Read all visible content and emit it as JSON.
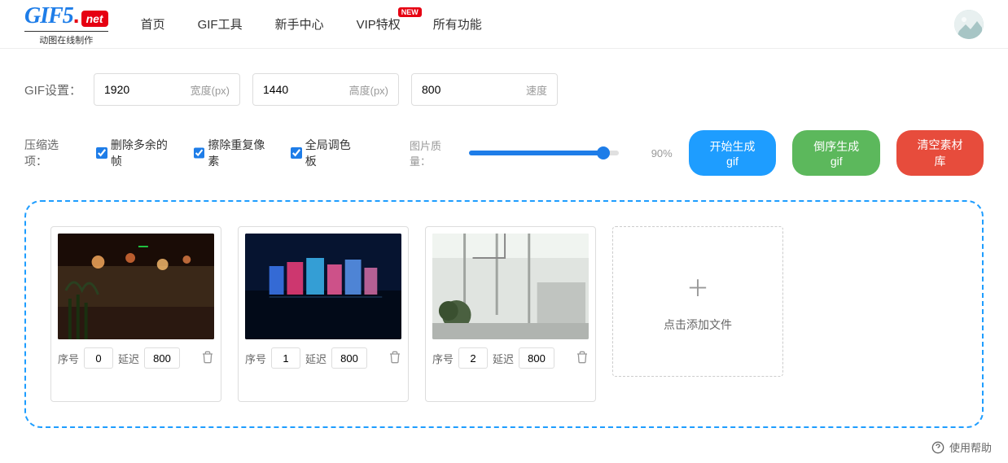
{
  "logo": {
    "main": "GIF5",
    "domain": "net",
    "tagline": "动图在线制作"
  },
  "nav": {
    "home": "首页",
    "tools": "GIF工具",
    "newbie": "新手中心",
    "vip": "VIP特权",
    "vip_badge": "NEW",
    "all": "所有功能"
  },
  "settings": {
    "label": "GIF设置：",
    "width_value": "1920",
    "width_suffix": "宽度(px)",
    "height_value": "1440",
    "height_suffix": "高度(px)",
    "speed_value": "800",
    "speed_suffix": "速度"
  },
  "compress": {
    "label": "压缩选项：",
    "opt1": "删除多余的帧",
    "opt2": "擦除重复像素",
    "opt3": "全局调色板"
  },
  "quality": {
    "label": "图片质量：",
    "value": "90%"
  },
  "buttons": {
    "start": "开始生成gif",
    "reverse": "倒序生成gif",
    "clear": "清空素材库"
  },
  "frame_labels": {
    "index": "序号",
    "delay": "延迟"
  },
  "frames": [
    {
      "index": "0",
      "delay": "800"
    },
    {
      "index": "1",
      "delay": "800"
    },
    {
      "index": "2",
      "delay": "800"
    }
  ],
  "add_file": "点击添加文件",
  "help": "使用帮助"
}
